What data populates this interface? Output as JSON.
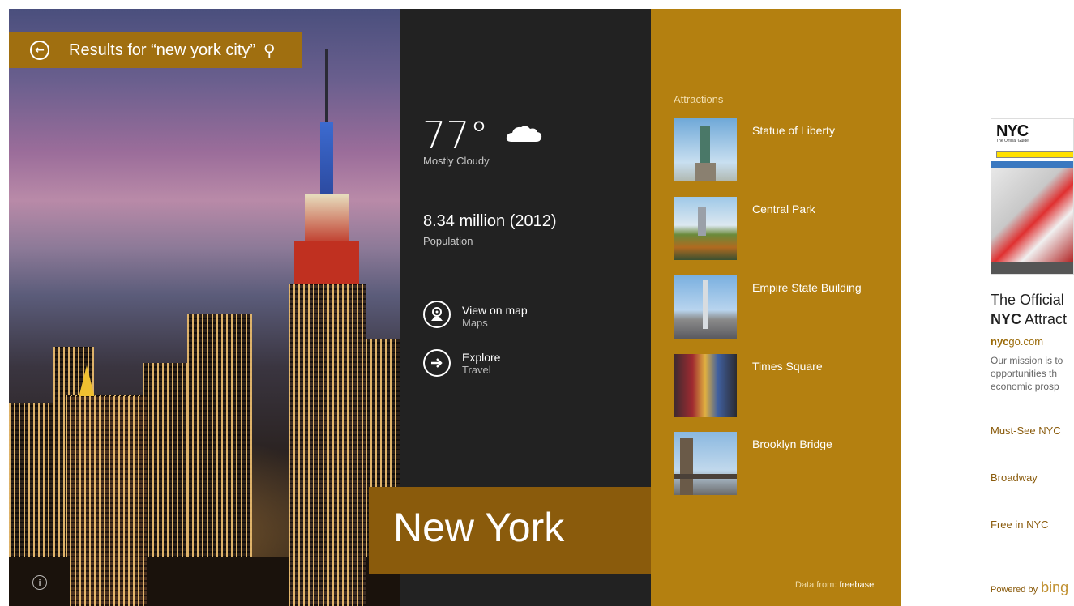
{
  "search": {
    "back_icon": "back-arrow-circle-icon",
    "label": "Results for “new york city”",
    "search_icon": "search-icon"
  },
  "city": {
    "name": "New York"
  },
  "weather": {
    "temperature": "77°",
    "condition": "Mostly Cloudy",
    "icon": "cloud-icon"
  },
  "population": {
    "value": "8.34 million (2012)",
    "label": "Population"
  },
  "actions": [
    {
      "title": "View on map",
      "subtitle": "Maps",
      "icon": "map-pin-icon"
    },
    {
      "title": "Explore",
      "subtitle": "Travel",
      "icon": "arrow-right-circle-icon"
    }
  ],
  "attractions": {
    "heading": "Attractions",
    "items": [
      {
        "name": "Statue of Liberty"
      },
      {
        "name": "Central Park"
      },
      {
        "name": "Empire State Building"
      },
      {
        "name": "Times Square"
      },
      {
        "name": "Brooklyn Bridge"
      }
    ],
    "data_from_label": "Data from:",
    "data_from_source": "freebase"
  },
  "web_result": {
    "thumb_logo": "NYC",
    "thumb_sub": "The Official Guide",
    "title_line1": "The Official",
    "title_bold": "NYC",
    "title_line2_rest": " Attract",
    "url_bold": "nyc",
    "url_rest": "go.com",
    "desc_lines": [
      "Our mission is to",
      "opportunities th",
      "economic prosp"
    ],
    "links": [
      "Must-See NYC",
      "Broadway",
      "Free in NYC"
    ],
    "powered_label": "Powered by",
    "powered_brand": "bing"
  },
  "colors": {
    "gold": "#b48010",
    "dark_gold": "#8a5b0c",
    "dark_panel": "#222222"
  }
}
